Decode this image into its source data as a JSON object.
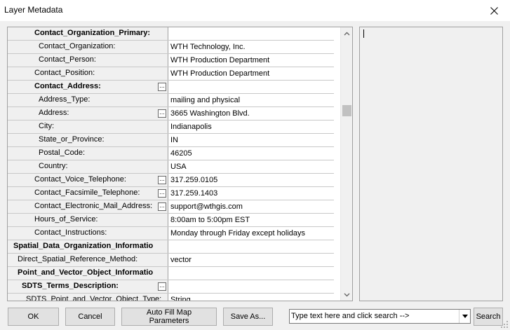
{
  "window": {
    "title": "Layer Metadata",
    "close_icon": "close-icon"
  },
  "grid": {
    "rows": [
      {
        "name": "Contact_Organization_Primary:",
        "value": "",
        "indent": 38,
        "bold": true,
        "ellipsis": false
      },
      {
        "name": "Contact_Organization:",
        "value": "WTH Technology, Inc.",
        "indent": 44,
        "bold": false,
        "ellipsis": false
      },
      {
        "name": "Contact_Person:",
        "value": "WTH Production Department",
        "indent": 44,
        "bold": false,
        "ellipsis": false
      },
      {
        "name": "Contact_Position:",
        "value": "WTH Production Department",
        "indent": 38,
        "bold": false,
        "ellipsis": false
      },
      {
        "name": "Contact_Address:",
        "value": "",
        "indent": 38,
        "bold": true,
        "ellipsis": true
      },
      {
        "name": "Address_Type:",
        "value": "mailing and physical",
        "indent": 44,
        "bold": false,
        "ellipsis": false
      },
      {
        "name": "Address:",
        "value": "3665 Washington Blvd.",
        "indent": 44,
        "bold": false,
        "ellipsis": true
      },
      {
        "name": "City:",
        "value": "Indianapolis",
        "indent": 44,
        "bold": false,
        "ellipsis": false
      },
      {
        "name": "State_or_Province:",
        "value": "IN",
        "indent": 44,
        "bold": false,
        "ellipsis": false
      },
      {
        "name": "Postal_Code:",
        "value": "46205",
        "indent": 44,
        "bold": false,
        "ellipsis": false
      },
      {
        "name": "Country:",
        "value": "USA",
        "indent": 44,
        "bold": false,
        "ellipsis": false
      },
      {
        "name": "Contact_Voice_Telephone:",
        "value": "317.259.0105",
        "indent": 38,
        "bold": false,
        "ellipsis": true
      },
      {
        "name": "Contact_Facsimile_Telephone:",
        "value": "317.259.1403",
        "indent": 38,
        "bold": false,
        "ellipsis": true
      },
      {
        "name": "Contact_Electronic_Mail_Address:",
        "value": "support@wthgis.com",
        "indent": 38,
        "bold": false,
        "ellipsis": true
      },
      {
        "name": "Hours_of_Service:",
        "value": "8:00am to 5:00pm EST",
        "indent": 38,
        "bold": false,
        "ellipsis": false
      },
      {
        "name": "Contact_Instructions:",
        "value": "Monday through Friday except holidays",
        "indent": 38,
        "bold": false,
        "ellipsis": false
      },
      {
        "name": "Spatial_Data_Organization_Informatio",
        "value": "",
        "indent": 8,
        "bold": true,
        "ellipsis": false
      },
      {
        "name": "Direct_Spatial_Reference_Method:",
        "value": "vector",
        "indent": 14,
        "bold": false,
        "ellipsis": false
      },
      {
        "name": "Point_and_Vector_Object_Informatio",
        "value": "",
        "indent": 14,
        "bold": true,
        "ellipsis": false
      },
      {
        "name": "SDTS_Terms_Description:",
        "value": "",
        "indent": 20,
        "bold": true,
        "ellipsis": true
      },
      {
        "name": "SDTS_Point_and_Vector_Object_Type:",
        "value": "String",
        "indent": 26,
        "bold": false,
        "ellipsis": false
      }
    ]
  },
  "buttons": {
    "ok": "OK",
    "cancel": "Cancel",
    "auto_fill": "Auto Fill Map Parameters",
    "save_as": "Save As...",
    "search": "Search"
  },
  "search": {
    "placeholder": "Type text here and click search -->"
  }
}
